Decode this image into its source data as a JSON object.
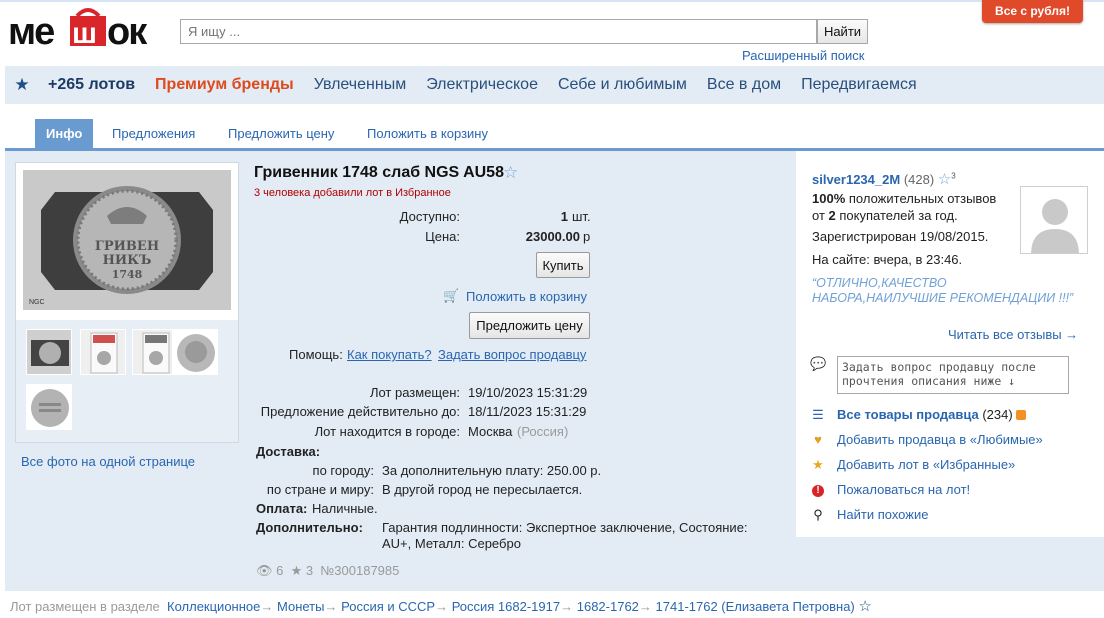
{
  "header": {
    "logo_text": "мешок",
    "search_placeholder": "Я ищу ...",
    "search_button": "Найти",
    "advanced_search": "Расширенный поиск",
    "promo_badge": "Все с рубля!"
  },
  "nav": {
    "lots": "+265 лотов",
    "items": [
      "Премиум бренды",
      "Увлеченным",
      "Электрическое",
      "Себе и любимым",
      "Все в дом",
      "Передвигаемся"
    ]
  },
  "tabs": [
    "Инфо",
    "Предложения",
    "Предложить цену",
    "Положить в корзину"
  ],
  "gallery": {
    "all_photos": "Все фото на одной странице"
  },
  "lot": {
    "title": "Гривенник 1748 слаб NGS AU58",
    "fav_note": "3 человека добавили лот в Избранное",
    "available_label": "Доступно:",
    "available_value": "1",
    "available_unit": "шт.",
    "price_label": "Цена:",
    "price_value": "23000.00",
    "price_unit": "р",
    "buy_button": "Купить",
    "add_to_cart": "Положить в корзину",
    "offer_button": "Предложить цену",
    "help_label": "Помощь:",
    "help_how": "Как покупать?",
    "help_ask": "Задать вопрос продавцу",
    "placed_label": "Лот размещен:",
    "placed_value": "19/10/2023 15:31:29",
    "valid_label": "Предложение действительно до:",
    "valid_value": "18/11/2023 15:31:29",
    "city_label": "Лот находится в городе:",
    "city_value": "Москва",
    "city_country": "(Россия)",
    "delivery_label": "Доставка:",
    "delivery_city_label": "по городу:",
    "delivery_city_value": "За дополнительную плату: 250.00 р.",
    "delivery_world_label": "по стране и миру:",
    "delivery_world_value": "В другой город не пересылается.",
    "payment_label": "Оплата:",
    "payment_value": "Наличные.",
    "extra_label": "Дополнительно:",
    "extra_value_1": "Гарантия подлинности: Экспертное заключение, Состояние:",
    "extra_value_2": "AU+, Металл: Серебро",
    "views": "6",
    "stars": "3",
    "lot_number": "№300187985"
  },
  "seller": {
    "name": "silver1234_2M",
    "rating": "(428)",
    "star_count": "3",
    "positive_pct": "100%",
    "positive_text": "положительных отзывов",
    "of_label": "от",
    "buyers_count": "2",
    "buyers_text": "покупателей за год.",
    "registered": "Зарегистрирован 19/08/2015.",
    "online": "На сайте: вчера, в 23:46.",
    "quote": "“ОТЛИЧНО,КАЧЕСТВО НАБОРА,НАИЛУЧШИЕ РЕКОМЕНДАЦИИ !!!”",
    "read_reviews": "Читать все отзывы →",
    "ask_placeholder": "Задать вопрос продавцу после прочтения описания ниже ↓",
    "all_goods": "Все товары продавца",
    "all_goods_count": "(234)",
    "add_seller_fav": "Добавить продавца в «Любимые»",
    "add_lot_fav": "Добавить лот в «Избранные»",
    "complain": "Пожаловаться на лот!",
    "find_similar": "Найти похожие"
  },
  "breadcrumb": {
    "label": "Лот размещен в разделе",
    "items": [
      "Коллекционное",
      "Монеты",
      "Россия и СССР",
      "Россия 1682-1917",
      "1682-1762",
      "1741-1762 (Елизавета Петровна)"
    ]
  },
  "colors": {
    "accent": "#2a66b0",
    "panel": "#e3ecf5",
    "tab_active": "#6a9bd0",
    "premium": "#dd4a1e",
    "promo": "#e0492a"
  }
}
